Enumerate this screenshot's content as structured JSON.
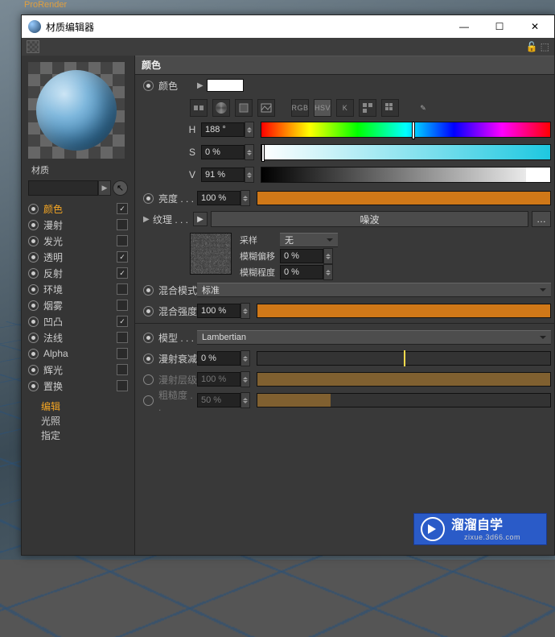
{
  "top_menu": {
    "pro_render": "ProRender"
  },
  "window": {
    "title": "材质编辑器",
    "min": "—",
    "max": "☐",
    "close": "✕"
  },
  "left": {
    "material_label": "材质",
    "channels": [
      {
        "name": "颜色",
        "checked": true,
        "active": true
      },
      {
        "name": "漫射",
        "checked": false
      },
      {
        "name": "发光",
        "checked": false
      },
      {
        "name": "透明",
        "checked": true
      },
      {
        "name": "反射",
        "checked": true
      },
      {
        "name": "环境",
        "checked": false
      },
      {
        "name": "烟雾",
        "checked": false
      },
      {
        "name": "凹凸",
        "checked": true
      },
      {
        "name": "法线",
        "checked": false
      },
      {
        "name": "Alpha",
        "checked": false
      },
      {
        "name": "辉光",
        "checked": false
      },
      {
        "name": "置换",
        "checked": false
      }
    ],
    "subitems": {
      "edit": "编辑",
      "illum": "光照",
      "assign": "指定"
    }
  },
  "right": {
    "section": "颜色",
    "color_label": "颜色",
    "icons": {
      "rgb": "RGB",
      "hsv": "HSV",
      "k": "K"
    },
    "hsv": {
      "h_label": "H",
      "h_value": "188 °",
      "s_label": "S",
      "s_value": "0 %",
      "v_label": "V",
      "v_value": "91 %"
    },
    "brightness": {
      "label": "亮度  . . .",
      "value": "100 %"
    },
    "texture": {
      "label": "纹理  . . .",
      "button": "噪波",
      "dots": "…"
    },
    "texparams": {
      "sample_label": "采样",
      "sample_value": "无",
      "bluroff_label": "模糊偏移",
      "bluroff_value": "0 %",
      "blurscale_label": "模糊程度",
      "blurscale_value": "0 %"
    },
    "mixmode": {
      "label": "混合模式",
      "value": "标准"
    },
    "mixstrength": {
      "label": "混合强度",
      "value": "100 %"
    },
    "model": {
      "label": "模型  . . .",
      "value": "Lambertian"
    },
    "falloff": {
      "label": "漫射衰减",
      "value": "0 %"
    },
    "level": {
      "label": "漫射层级",
      "value": "100 %"
    },
    "rough": {
      "label": "粗糙度 . .",
      "value": "50 %"
    }
  },
  "watermark": {
    "text": "溜溜自学",
    "sub": "zixue.3d66.com"
  }
}
